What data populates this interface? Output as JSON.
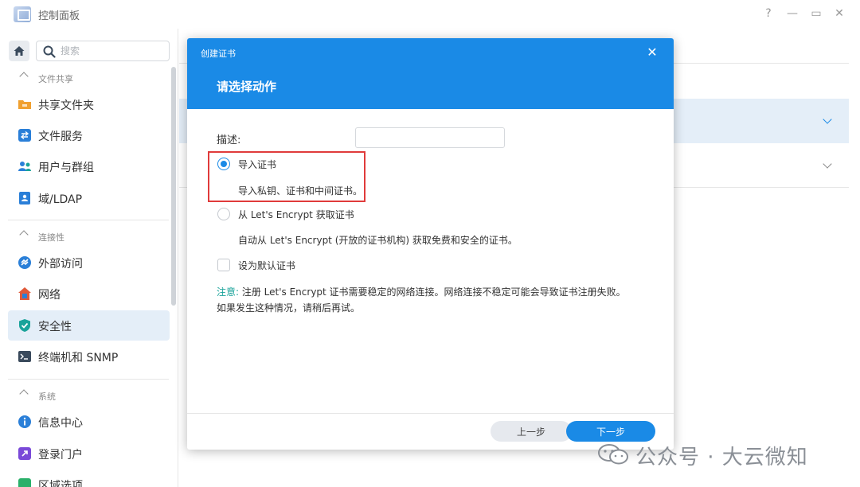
{
  "window": {
    "title": "控制面板",
    "controls": {
      "help": "?",
      "minimize": "—",
      "maximize": "▭",
      "close": "✕"
    }
  },
  "sidebar": {
    "search_placeholder": "搜索",
    "sections": [
      {
        "label": "文件共享",
        "items": [
          {
            "label": "共享文件夹",
            "icon": "shared-folder-icon",
            "color": "#f0a030"
          },
          {
            "label": "文件服务",
            "icon": "file-services-icon",
            "color": "#2a7fd8"
          },
          {
            "label": "用户与群组",
            "icon": "users-groups-icon",
            "color": "#2a7fd8"
          },
          {
            "label": "域/LDAP",
            "icon": "domain-ldap-icon",
            "color": "#2a7fd8"
          }
        ]
      },
      {
        "label": "连接性",
        "items": [
          {
            "label": "外部访问",
            "icon": "external-access-icon",
            "color": "#2a7fd8"
          },
          {
            "label": "网络",
            "icon": "network-icon",
            "color": "#e05a3a"
          },
          {
            "label": "安全性",
            "icon": "security-shield-icon",
            "color": "#1aa39a",
            "active": true
          },
          {
            "label": "终端机和 SNMP",
            "icon": "terminal-icon",
            "color": "#3a4a5c"
          }
        ]
      },
      {
        "label": "系统",
        "items": [
          {
            "label": "信息中心",
            "icon": "info-center-icon",
            "color": "#2a7fd8"
          },
          {
            "label": "登录门户",
            "icon": "login-portal-icon",
            "color": "#7a4ad8"
          },
          {
            "label": "区域选项",
            "icon": "regional-options-icon",
            "color": "#2ab06a"
          }
        ]
      }
    ]
  },
  "dialog": {
    "small_title": "创建证书",
    "heading": "请选择动作",
    "description_label": "描述:",
    "description_value": "",
    "options": [
      {
        "label": "导入证书",
        "desc": "导入私钥、证书和中间证书。",
        "checked": true
      },
      {
        "label": "从 Let's Encrypt 获取证书",
        "desc": "自动从 Let's Encrypt (开放的证书机构) 获取免费和安全的证书。",
        "checked": false
      }
    ],
    "default_cert_label": "设为默认证书",
    "note_key": "注意:",
    "note_line1": " 注册 Let's Encrypt 证书需要稳定的网络连接。网络连接不稳定可能会导致证书注册失败。",
    "note_line2": "如果发生这种情况，请稍后再试。",
    "prev_label": "上一步",
    "next_label": "下一步"
  },
  "watermark": {
    "text": "公众号 · 大云微知"
  },
  "colors": {
    "accent": "#1a8ae6",
    "highlight_border": "#e03b3b",
    "note_key": "#1aa39a",
    "active_item_bg": "#e4eef8"
  }
}
